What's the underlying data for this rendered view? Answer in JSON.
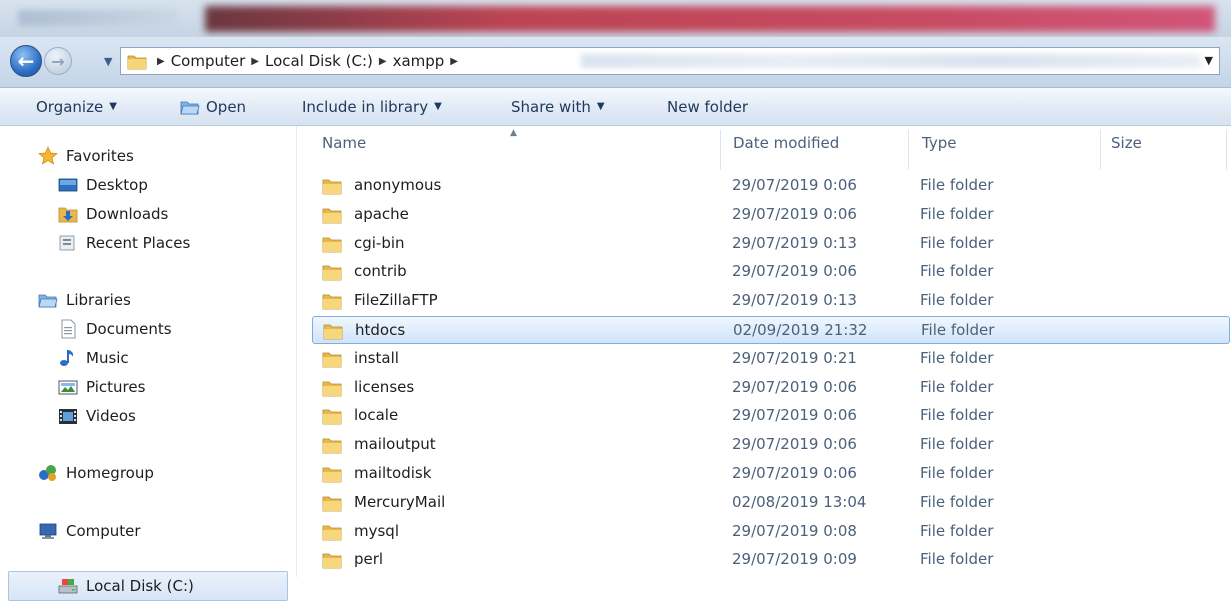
{
  "address_bar": {
    "crumbs": [
      "Computer",
      "Local Disk (C:)",
      "xampp"
    ]
  },
  "toolbar": {
    "organize_label": "Organize",
    "open_label": "Open",
    "include_label": "Include in library",
    "share_label": "Share with",
    "new_folder_label": "New folder"
  },
  "nav": {
    "favorites": "Favorites",
    "desktop": "Desktop",
    "downloads": "Downloads",
    "recent": "Recent Places",
    "libraries": "Libraries",
    "documents": "Documents",
    "music": "Music",
    "pictures": "Pictures",
    "videos": "Videos",
    "homegroup": "Homegroup",
    "computer": "Computer",
    "local_disk": "Local Disk (C:)"
  },
  "columns": {
    "name": "Name",
    "date": "Date modified",
    "type": "Type",
    "size": "Size"
  },
  "files": [
    {
      "name": "anonymous",
      "date": "29/07/2019 0:06",
      "type": "File folder"
    },
    {
      "name": "apache",
      "date": "29/07/2019 0:06",
      "type": "File folder"
    },
    {
      "name": "cgi-bin",
      "date": "29/07/2019 0:13",
      "type": "File folder"
    },
    {
      "name": "contrib",
      "date": "29/07/2019 0:06",
      "type": "File folder"
    },
    {
      "name": "FileZillaFTP",
      "date": "29/07/2019 0:13",
      "type": "File folder"
    },
    {
      "name": "htdocs",
      "date": "02/09/2019 21:32",
      "type": "File folder"
    },
    {
      "name": "install",
      "date": "29/07/2019 0:21",
      "type": "File folder"
    },
    {
      "name": "licenses",
      "date": "29/07/2019 0:06",
      "type": "File folder"
    },
    {
      "name": "locale",
      "date": "29/07/2019 0:06",
      "type": "File folder"
    },
    {
      "name": "mailoutput",
      "date": "29/07/2019 0:06",
      "type": "File folder"
    },
    {
      "name": "mailtodisk",
      "date": "29/07/2019 0:06",
      "type": "File folder"
    },
    {
      "name": "MercuryMail",
      "date": "02/08/2019 13:04",
      "type": "File folder"
    },
    {
      "name": "mysql",
      "date": "29/07/2019 0:08",
      "type": "File folder"
    },
    {
      "name": "perl",
      "date": "29/07/2019 0:09",
      "type": "File folder"
    }
  ],
  "selected_file": "htdocs",
  "colors": {
    "accent": "#1e395b",
    "selection_border": "#84acdd",
    "folder": "#e8b84a"
  }
}
